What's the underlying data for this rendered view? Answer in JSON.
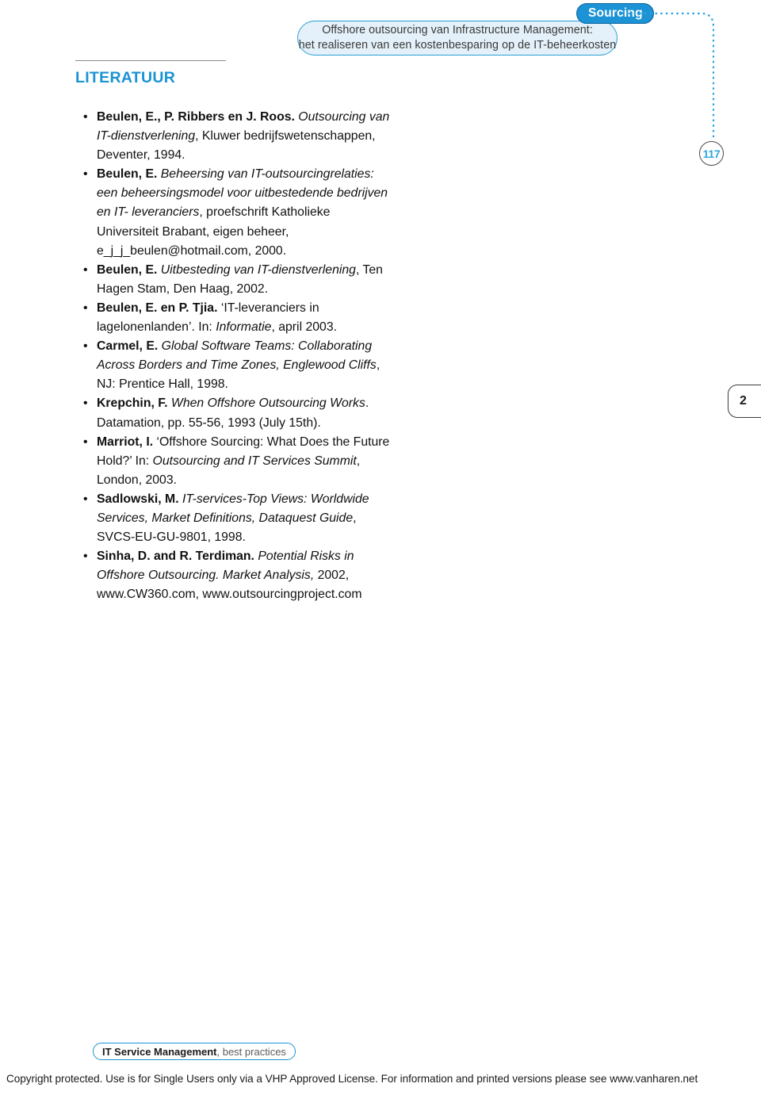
{
  "header": {
    "badge_label": "Sourcing",
    "chapter_title_line1": "Offshore outsourcing van Infrastructure Management:",
    "chapter_title_line2": "het realiseren van een kostenbesparing op de IT-beheerkosten",
    "page_number": "117",
    "accent_color": "#1b93d4",
    "bubble_fill": "#e4f1fa",
    "page_number_color": "#2ca6dd"
  },
  "chapter_tab": {
    "label": "2"
  },
  "main": {
    "section_heading": "LITERATUUR",
    "heading_color": "#1a93d4",
    "references": [
      {
        "segments": [
          {
            "style": "bold",
            "text": "Beulen, E., P. Ribbers en J. Roos."
          },
          {
            "style": "italic",
            "text": " Outsourcing van IT-dienstverlening"
          },
          {
            "style": "normal",
            "text": ", Kluwer bedrijfswetenschappen, Deventer, 1994."
          }
        ]
      },
      {
        "segments": [
          {
            "style": "bold",
            "text": "Beulen, E."
          },
          {
            "style": "italic",
            "text": " Beheersing van IT-outsourcingrelaties: een beheersingsmodel voor uitbestedende bedrijven en IT- leveranciers"
          },
          {
            "style": "normal",
            "text": ", proefschrift Katholieke Universiteit Brabant, eigen beheer, e_j_j_beulen@hotmail.com, 2000."
          }
        ]
      },
      {
        "segments": [
          {
            "style": "bold",
            "text": "Beulen, E."
          },
          {
            "style": "italic",
            "text": " Uitbesteding van IT-dienstverlening"
          },
          {
            "style": "normal",
            "text": ", Ten Hagen Stam, Den Haag, 2002."
          }
        ]
      },
      {
        "segments": [
          {
            "style": "bold",
            "text": "Beulen, E. en P. Tjia."
          },
          {
            "style": "normal",
            "text": " ‘IT-leveranciers in lagelonenlanden’. In: "
          },
          {
            "style": "italic",
            "text": "Informatie"
          },
          {
            "style": "normal",
            "text": ", april 2003."
          }
        ]
      },
      {
        "segments": [
          {
            "style": "bold",
            "text": "Carmel, E."
          },
          {
            "style": "italic",
            "text": " Global Software Teams: Collaborating Across Borders and Time Zones, Englewood Cliffs"
          },
          {
            "style": "normal",
            "text": ", NJ: Prentice Hall, 1998."
          }
        ]
      },
      {
        "segments": [
          {
            "style": "bold",
            "text": "Krepchin, F."
          },
          {
            "style": "italic",
            "text": " When Offshore Outsourcing Works"
          },
          {
            "style": "normal",
            "text": ". Datamation, pp. 55-56, 1993 (July 15th)."
          }
        ]
      },
      {
        "segments": [
          {
            "style": "bold",
            "text": "Marriot, I."
          },
          {
            "style": "normal",
            "text": " ‘Offshore Sourcing: What Does the Future Hold?’ In: "
          },
          {
            "style": "italic",
            "text": "Outsourcing and IT Services Summit"
          },
          {
            "style": "normal",
            "text": ", London, 2003."
          }
        ]
      },
      {
        "segments": [
          {
            "style": "bold",
            "text": "Sadlowski, M."
          },
          {
            "style": "italic",
            "text": " IT-services-Top Views: Worldwide Services, Market Definitions, Dataquest Guide"
          },
          {
            "style": "normal",
            "text": ", SVCS-EU-GU-9801, 1998."
          }
        ]
      },
      {
        "segments": [
          {
            "style": "bold",
            "text": "Sinha, D. and R. Terdiman."
          },
          {
            "style": "italic",
            "text": " Potential Risks in Offshore Outsourcing. Market Analysis,"
          },
          {
            "style": "normal",
            "text": " 2002, www.CW360.com, www.outsourcingproject.com"
          }
        ]
      }
    ]
  },
  "footer": {
    "brand_strong": "IT Service Management",
    "brand_sub": ", best practices",
    "copyright": "Copyright protected. Use is for Single Users only via a VHP Approved License. For information and printed versions please see www.vanharen.net"
  }
}
